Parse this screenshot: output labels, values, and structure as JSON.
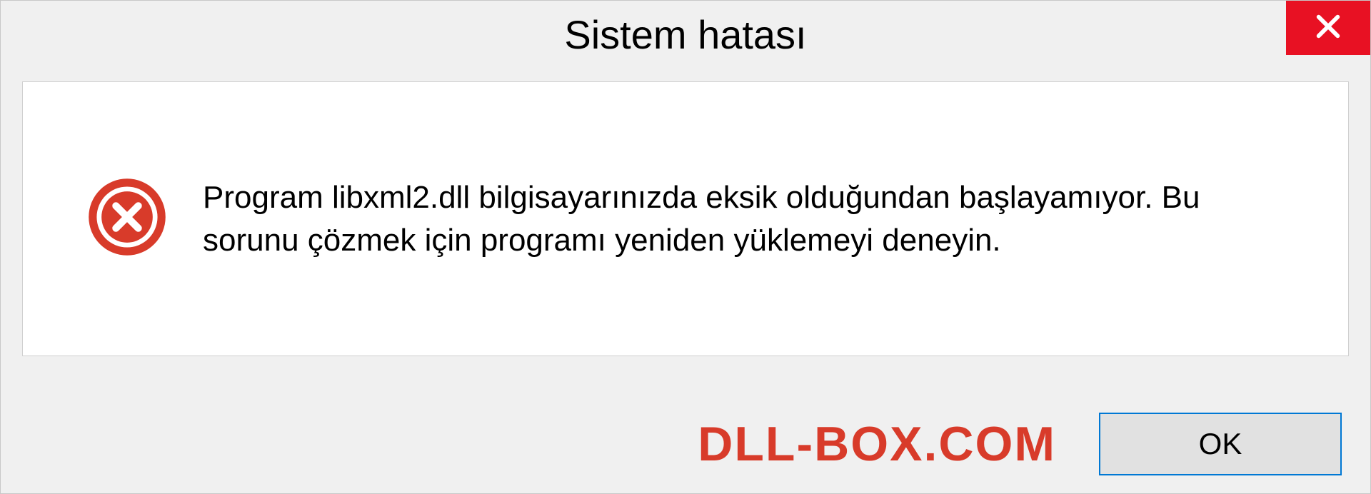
{
  "dialog": {
    "title": "Sistem hatası",
    "message": "Program libxml2.dll bilgisayarınızda eksik olduğundan başlayamıyor. Bu sorunu çözmek için programı yeniden yüklemeyi deneyin.",
    "ok_label": "OK"
  },
  "watermark": "DLL-BOX.COM"
}
